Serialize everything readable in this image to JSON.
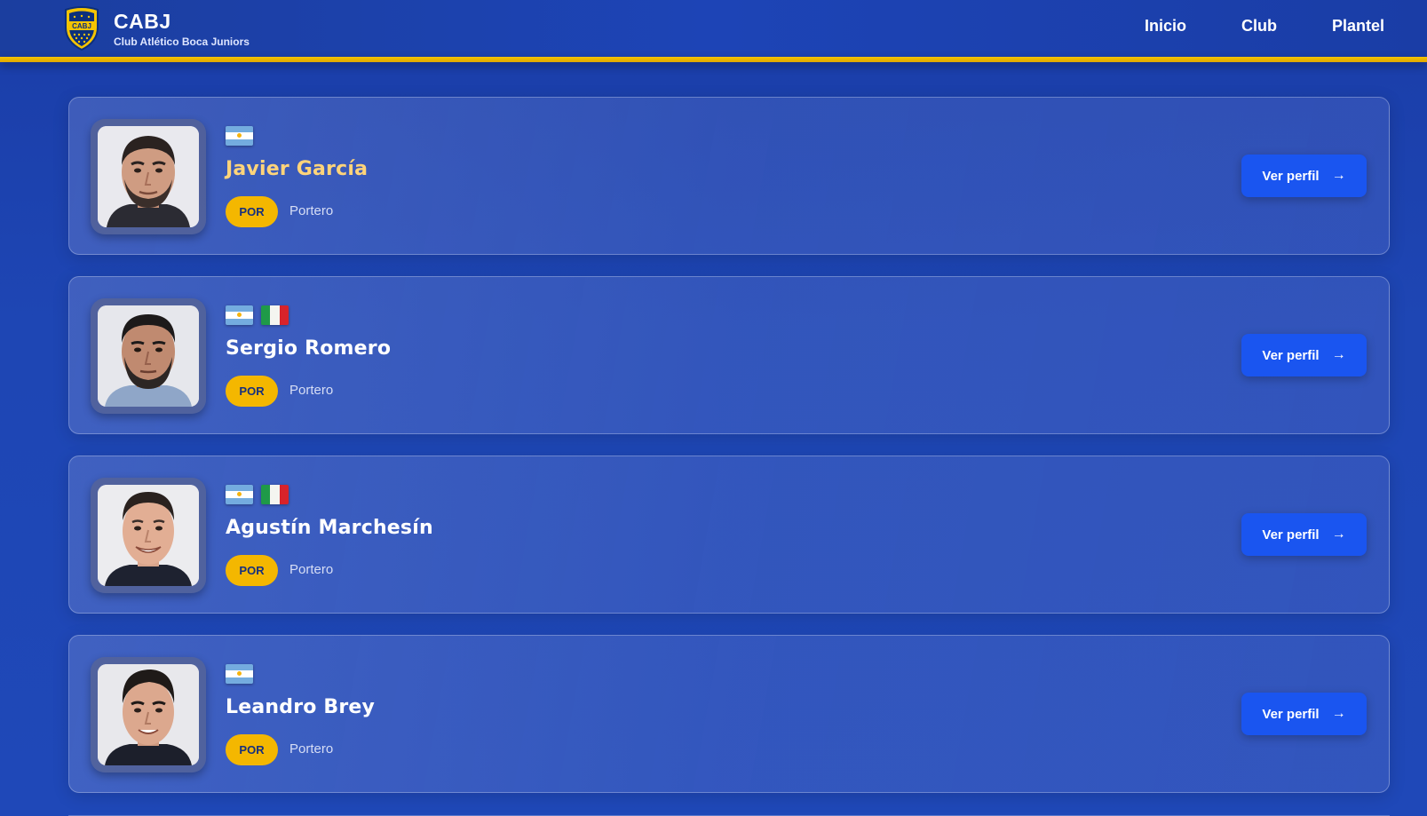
{
  "header": {
    "brand_title": "CABJ",
    "brand_subtitle": "Club Atlético Boca Juniors",
    "crest_text": "CABJ",
    "nav": [
      {
        "label": "Inicio"
      },
      {
        "label": "Club"
      },
      {
        "label": "Plantel"
      }
    ]
  },
  "colors": {
    "primary_blue": "#1e46b4",
    "gold": "#f5c400",
    "button_blue": "#1a55f0",
    "highlight_name": "#ffd47a"
  },
  "players": [
    {
      "name": "Javier García",
      "flags": [
        "argentina-flag-icon"
      ],
      "position_code": "POR",
      "position": "Portero",
      "cta": "Ver perfil",
      "arrow": "→"
    },
    {
      "name": "Sergio Romero",
      "flags": [
        "argentina-flag-icon",
        "italy-flag-icon"
      ],
      "position_code": "POR",
      "position": "Portero",
      "cta": "Ver perfil",
      "arrow": "→"
    },
    {
      "name": "Agustín Marchesín",
      "flags": [
        "argentina-flag-icon",
        "italy-flag-icon"
      ],
      "position_code": "POR",
      "position": "Portero",
      "cta": "Ver perfil",
      "arrow": "→"
    },
    {
      "name": "Leandro Brey",
      "flags": [
        "argentina-flag-icon"
      ],
      "position_code": "POR",
      "position": "Portero",
      "cta": "Ver perfil",
      "arrow": "→"
    }
  ]
}
